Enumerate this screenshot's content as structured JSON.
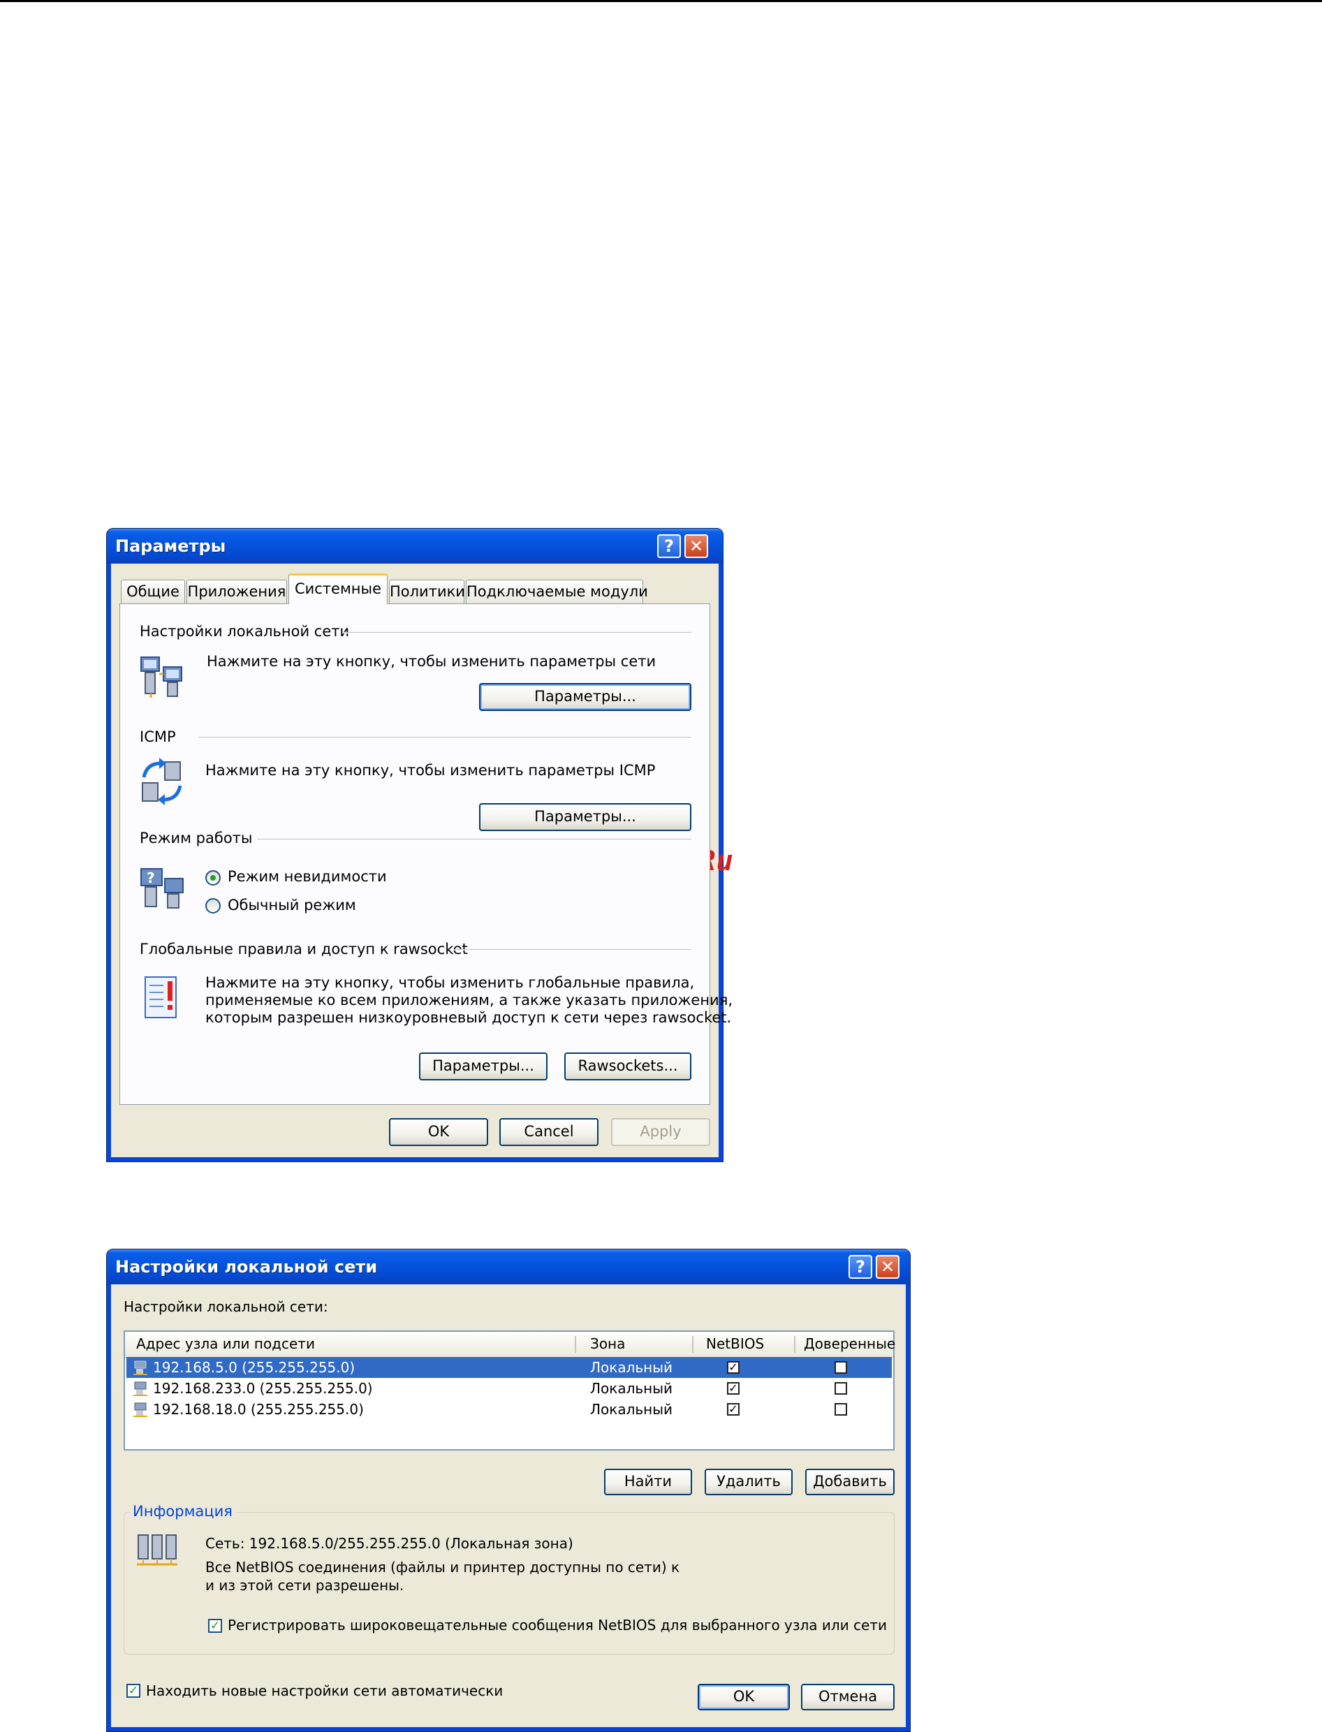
{
  "dialog1": {
    "title": "Параметры",
    "help_glyph": "?",
    "close_glyph": "✕",
    "tabs": [
      {
        "label": "Общие"
      },
      {
        "label": "Приложения"
      },
      {
        "label": "Системные",
        "active": true
      },
      {
        "label": "Политики"
      },
      {
        "label": "Подключаемые модули"
      }
    ],
    "lan": {
      "heading": "Настройки локальной сети",
      "desc": "Нажмите на эту кнопку, чтобы изменить параметры сети",
      "button": "Параметры..."
    },
    "icmp": {
      "heading": "ICMP",
      "desc": "Нажмите на эту кнопку, чтобы изменить параметры ICMP",
      "button": "Параметры..."
    },
    "mode": {
      "heading": "Режим работы",
      "stealth": "Режим невидимости",
      "normal": "Обычный режим",
      "selected": "stealth"
    },
    "rules": {
      "heading": "Глобальные правила и доступ к rawsocket",
      "desc_lines": [
        "Нажмите на эту кнопку, чтобы изменить глобальные правила,",
        "применяемые ко всем приложениям, а также указать приложения,",
        "которым разрешен низкоуровневый доступ к сети через rawsocket."
      ],
      "params_button": "Параметры...",
      "rawsockets_button": "Rawsockets..."
    },
    "footer": {
      "ok": "OK",
      "cancel": "Cancel",
      "apply": "Apply"
    }
  },
  "watermark": "McGrp.Ru",
  "dialog2": {
    "title": "Настройки локальной сети",
    "help_glyph": "?",
    "close_glyph": "✕",
    "list_label": "Настройки локальной сети:",
    "columns": [
      "Адрес узла или подсети",
      "Зона",
      "NetBIOS",
      "Доверенные"
    ],
    "rows": [
      {
        "address": "192.168.5.0 (255.255.255.0)",
        "zone": "Локальный",
        "netbios": true,
        "trusted": false,
        "selected": true
      },
      {
        "address": "192.168.233.0 (255.255.255.0)",
        "zone": "Локальный",
        "netbios": true,
        "trusted": false,
        "selected": false
      },
      {
        "address": "192.168.18.0 (255.255.255.0)",
        "zone": "Локальный",
        "netbios": true,
        "trusted": false,
        "selected": false
      }
    ],
    "buttons": {
      "find": "Найти",
      "delete": "Удалить",
      "add": "Добавить"
    },
    "info": {
      "title": "Информация",
      "network": "Сеть: 192.168.5.0/255.255.255.0 (Локальная зона)",
      "netbios_line1": "Все NetBIOS соединения (файлы и принтер доступны по сети) к",
      "netbios_line2": "и из этой сети разрешены.",
      "register_broadcast": "Регистрировать широковещательные сообщения NetBIOS для выбранного узла или сети",
      "register_checked": true
    },
    "auto_detect": "Находить новые настройки сети автоматически",
    "auto_detect_checked": true,
    "footer": {
      "ok": "OK",
      "cancel": "Отмена"
    }
  }
}
